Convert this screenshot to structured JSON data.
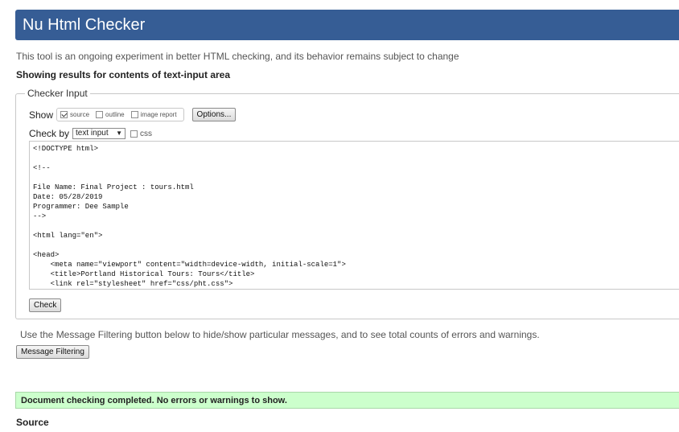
{
  "header": {
    "title": "Nu Html Checker"
  },
  "intro_text": "This tool is an ongoing experiment in better HTML checking, and its behavior remains subject to change",
  "showing_text": "Showing results for contents of text-input area",
  "checker": {
    "legend": "Checker Input",
    "show_label": "Show",
    "show_options": [
      {
        "label": "source",
        "checked": true
      },
      {
        "label": "outline",
        "checked": false
      },
      {
        "label": "image report",
        "checked": false
      }
    ],
    "options_button": "Options...",
    "check_by_label": "Check by",
    "check_by_value": "text input",
    "css_label": "css",
    "source_code": "<!DOCTYPE html>\n\n<!--\n\nFile Name: Final Project : tours.html\nDate: 05/28/2019\nProgrammer: Dee Sample\n-->\n\n<html lang=\"en\">\n\n<head>\n    <meta name=\"viewport\" content=\"width=device-width, initial-scale=1\">\n    <title>Portland Historical Tours: Tours</title>\n    <link rel=\"stylesheet\" href=\"css/pht.css\">",
    "check_button": "Check"
  },
  "filtering": {
    "text": "Use the Message Filtering button below to hide/show particular messages, and to see total counts of errors and warnings.",
    "button": "Message Filtering"
  },
  "result": {
    "message": "Document checking completed. No errors or warnings to show."
  },
  "source_heading": "Source"
}
